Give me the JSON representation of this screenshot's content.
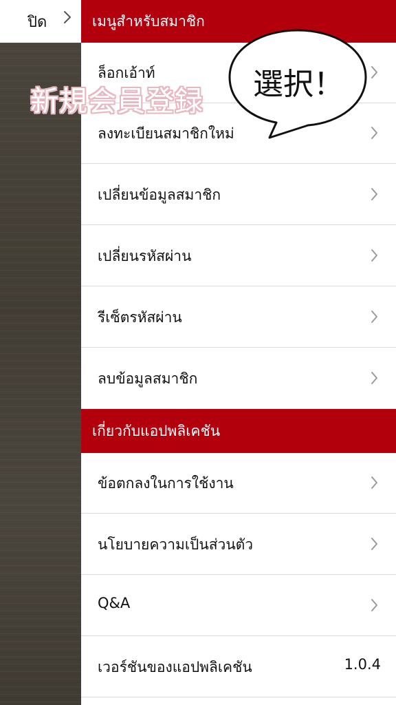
{
  "close": {
    "label": "ปิด"
  },
  "sections": [
    {
      "header": "เมนูสำหรับสมาชิก",
      "items": [
        {
          "label": "ล็อกเอ้าท์"
        },
        {
          "label": "ลงทะเบียนสมาชิกใหม่"
        },
        {
          "label": "เปลี่ยนข้อมูลสมาชิก"
        },
        {
          "label": "เปลี่ยนรหัสผ่าน"
        },
        {
          "label": "รีเซ็ตรหัสผ่าน"
        },
        {
          "label": "ลบข้อมูลสมาชิก"
        }
      ]
    },
    {
      "header": "เกี่ยวกับแอปพลิเคชัน",
      "items": [
        {
          "label": "ข้อตกลงในการใช้งาน"
        },
        {
          "label": "นโยบายความเป็นส่วนตัว"
        },
        {
          "label": "Q&A"
        },
        {
          "label": "เวอร์ชันของแอปพลิเคชัน",
          "value": "1.0.4"
        }
      ]
    }
  ],
  "annotation": {
    "overlay_text": "新規会員登録",
    "bubble_text": "選択！"
  },
  "colors": {
    "header_red": "#b3000d",
    "wood": "#46413a"
  },
  "icons": {
    "row_chevron": "chevron-right-icon",
    "close_chevron": "chevron-right-icon"
  }
}
